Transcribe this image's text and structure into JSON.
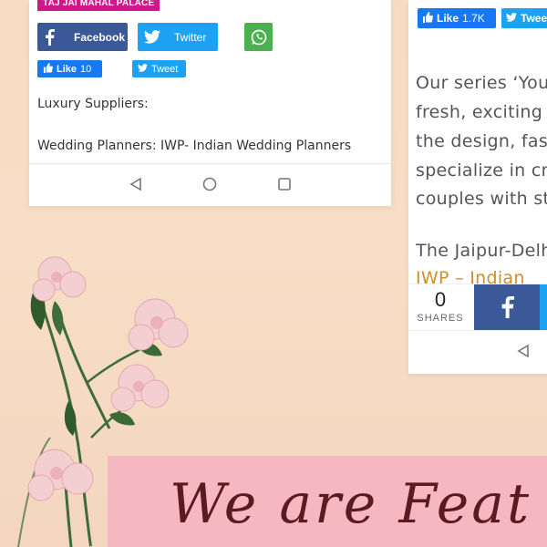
{
  "left_card": {
    "tag": "TAJ JAI MAHAL PALACE",
    "share_facebook": "Facebook",
    "share_twitter": "Twitter",
    "like_label": "Like",
    "like_count": "10",
    "tweet_label": "Tweet",
    "line1": "Luxury Suppliers:",
    "line2": "Wedding Planners: IWP- Indian Wedding Planners"
  },
  "right_card": {
    "like_label": "Like",
    "like_count": "1.7K",
    "tweet_label": "Twee",
    "para1": [
      "Our  series  ‘You",
      "fresh,  exciting  n",
      "the  design,  fash",
      "specialize  in  cr",
      "couples with sta"
    ],
    "para2_line1": "The  Jaipur-Delh",
    "para2_link": "IWP  –  Indian",
    "shares_count": "0",
    "shares_label": "SHARES"
  },
  "banner": {
    "headline": "We are Feat"
  },
  "colors": {
    "facebook": "#3b5998",
    "twitter": "#1da1f2",
    "whatsapp": "#4caf50",
    "tag": "#d1168a",
    "banner": "#f6b8c0",
    "headline": "#5a1a22",
    "link": "#c9902e"
  },
  "icons": [
    "facebook-icon",
    "twitter-icon",
    "whatsapp-icon",
    "thumbs-up-icon",
    "back-nav-icon",
    "home-nav-icon",
    "recents-nav-icon"
  ]
}
